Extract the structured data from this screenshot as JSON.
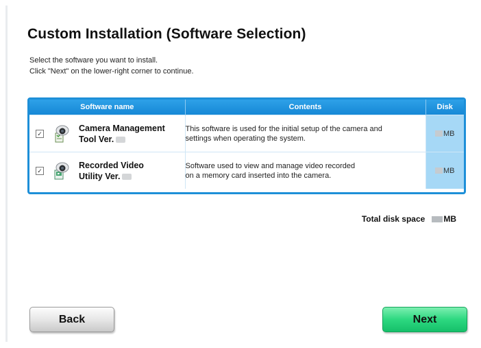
{
  "page": {
    "title": "Custom Installation (Software Selection)",
    "instruction_line1": "Select the software you want to install.",
    "instruction_line2": "Click \"Next\" on the lower-right corner to continue."
  },
  "table": {
    "headers": {
      "name": "Software name",
      "contents": "Contents",
      "disk": "Disk"
    },
    "rows": [
      {
        "checked": true,
        "checkmark": "✓",
        "icon": "camera-management-icon",
        "name_line1": "Camera Management",
        "name_line2": "Tool Ver.",
        "contents_line1": "This software is used for the initial setup of the camera and",
        "contents_line2": "settings when operating the system.",
        "disk_unit": "MB"
      },
      {
        "checked": true,
        "checkmark": "✓",
        "icon": "recorded-video-icon",
        "name_line1": "Recorded Video",
        "name_line2": "Utility Ver.",
        "contents_line1": "Software used to view and manage video recorded",
        "contents_line2": "on a memory card inserted into the camera.",
        "disk_unit": "MB"
      }
    ]
  },
  "summary": {
    "label": "Total disk space",
    "unit": "MB"
  },
  "buttons": {
    "back": "Back",
    "next": "Next"
  },
  "colors": {
    "table_border": "#1d8fd8",
    "header_bg": "#1688d6",
    "disk_cell_bg": "#a6d8f6",
    "next_button": "#2dd880"
  }
}
